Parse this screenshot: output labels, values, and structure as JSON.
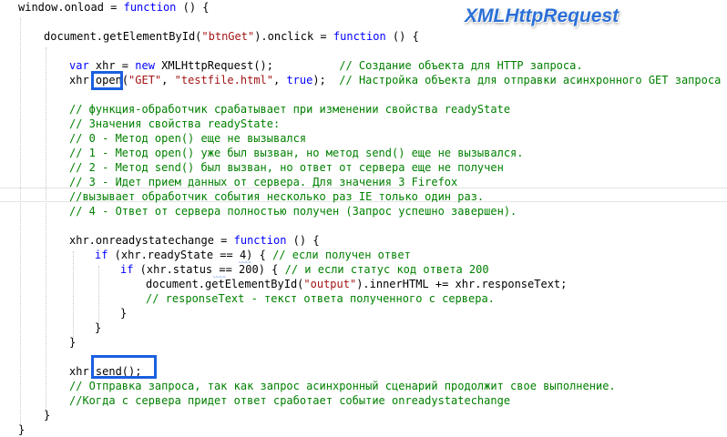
{
  "title_overlay": "XMLHttpRequest",
  "colors": {
    "keyword": "#0000ff",
    "string": "#a31515",
    "comment": "#008000",
    "highlight_box": "#1a5fe0",
    "title": "#2b6fd6"
  },
  "code": {
    "l1": {
      "a": "window.onload = ",
      "b": "function",
      "c": " () {"
    },
    "l2": {
      "a": "document.getElementById(",
      "b": "\"btnGet\"",
      "c": ").onclick = ",
      "d": "function",
      "e": " () {"
    },
    "l3": {
      "a": "var",
      "b": " xhr = ",
      "c": "new",
      "d": " XMLHttpRequest();          ",
      "e": "// Создание объекта для HTTP запроса."
    },
    "l4": {
      "a": "xhr.",
      "b": "open",
      "c": "(",
      "d": "\"GET\"",
      "e": ", ",
      "f": "\"testfile.html\"",
      "g": ", ",
      "h": "true",
      "i": ");  ",
      "j": "// Настройка объекта для отправки асинхронного GET запроса"
    },
    "l5": "// функция-обработчик срабатывает при изменении свойства readyState",
    "l6": "// Значения свойства readyState:",
    "l7": "// 0 - Метод open() еще не вызывался",
    "l8": "// 1 - Метод open() уже был вызван, но метод send() еще не вызывался.",
    "l9": "// 2 - Метод send() был вызван, но ответ от сервера еще не получен",
    "l10": "// 3 - Идет прием данных от сервера. Для значения 3 Firefox",
    "l11": "//вызывает обработчик события несколько раз IE только один раз.",
    "l12": "// 4 - Ответ от сервера полностью получен (Запрос успешно завершен).",
    "l13": {
      "a": "xhr.onreadystatechange = ",
      "b": "function",
      "c": " () {"
    },
    "l14": {
      "a": "if",
      "b": " (xhr.readyState == 4) { ",
      "c": "// если получен ответ"
    },
    "l15": {
      "a": "if",
      "b": " (xhr.status == 200) { ",
      "c": "// и если статус код ответа 200"
    },
    "l16": {
      "a": "document.getElementById(",
      "b": "\"output\"",
      "c": ").innerHTML += xhr.responseText;"
    },
    "l17": "// responseText - текст ответа полученного с сервера.",
    "l18": "}",
    "l19": "}",
    "l20": "}",
    "l21": {
      "a": "xhr.",
      "b": "send();"
    },
    "l22": "// Отправка запроса, так как запрос асинхронный сценарий продолжит свое выполнение.",
    "l23": "//Когда с сервера придет ответ сработает событие onreadystatechange",
    "l24": "}",
    "l25": "}"
  }
}
